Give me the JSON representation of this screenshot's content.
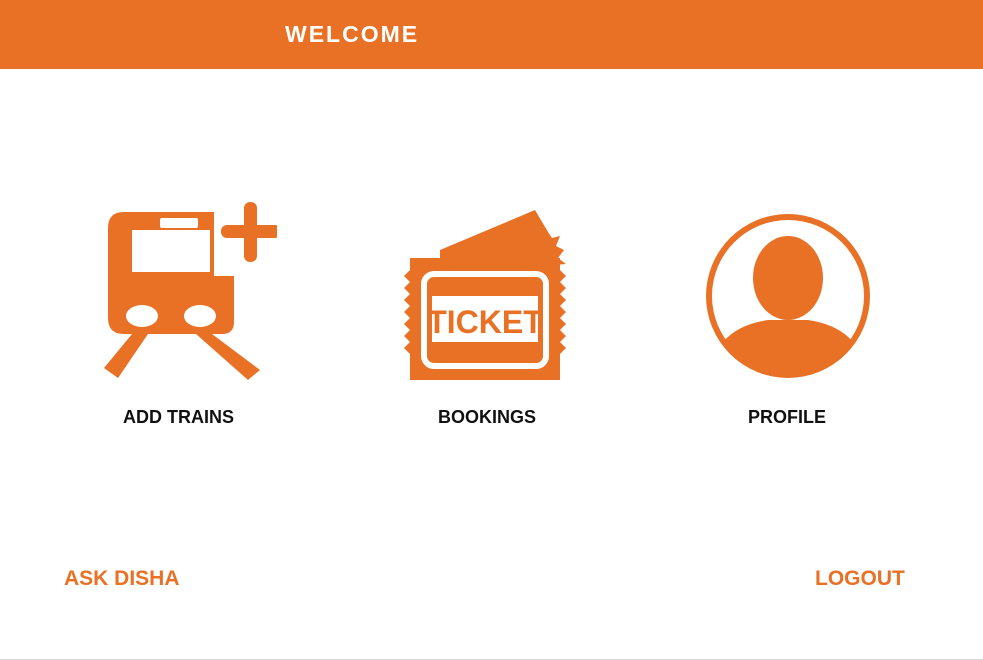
{
  "header": {
    "title": "WELCOME"
  },
  "tiles": [
    {
      "label": "ADD TRAINS",
      "icon": "train-add-icon"
    },
    {
      "label": "BOOKINGS",
      "icon": "ticket-icon",
      "icon_text": "TICKET"
    },
    {
      "label": "PROFILE",
      "icon": "user-avatar-icon"
    }
  ],
  "footer": {
    "ask_label": "ASK DISHA",
    "logout_label": "LOGOUT"
  },
  "colors": {
    "accent": "#e87125",
    "background": "#ffffff",
    "label_text": "#111111"
  }
}
